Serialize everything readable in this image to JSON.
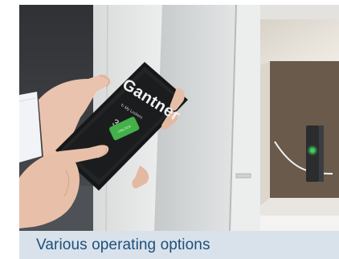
{
  "caption": {
    "text": "Various operating options"
  },
  "phone": {
    "brand": "Gantner",
    "small_text": "↻ My Lockers",
    "locker_number": "3",
    "button_label": "UNLOCK"
  },
  "colors": {
    "caption_background": "#d9e2ea",
    "caption_text": "#1e4f7d",
    "unlock_button": "#43b049",
    "led": "#27e14a"
  }
}
